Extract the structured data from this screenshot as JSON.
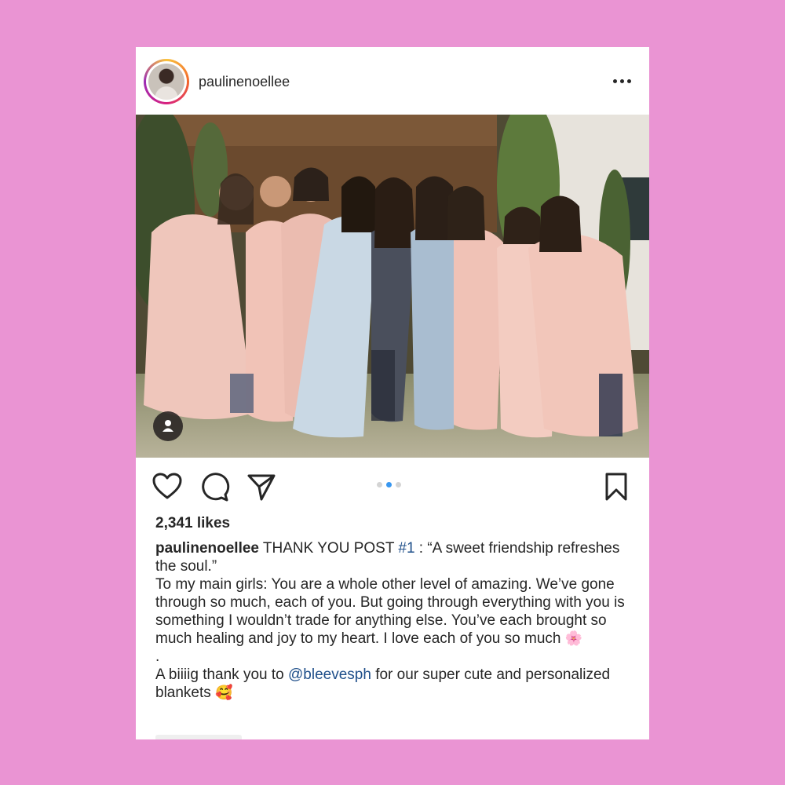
{
  "post": {
    "username": "paulinenoellee",
    "likes": "2,341 likes",
    "caption": {
      "username": "paulinenoellee",
      "line1_a": " THANK YOU POST ",
      "hashtag": "#1",
      "line1_b": " : “A sweet friendship refreshes the soul.”",
      "para2": "To my main girls: You are a whole other level of amazing. We’ve gone through so much, each of you. But going through everything with you is something I wouldn’t trade for anything else. You’ve each brought so much healing and joy to my heart. I love each of you so much",
      "para2_emoji": "🌸",
      "dot": ".",
      "para3_a": "A biiiig thank you to ",
      "mention": "@bleevesph",
      "para3_b": " for our super cute and personalized blankets",
      "para3_emoji": "🥰"
    },
    "carousel": {
      "count": 3,
      "active": 1
    }
  },
  "icons": {
    "header": "more-options-icon",
    "actions": [
      "heart-icon",
      "comment-icon",
      "share-icon",
      "bookmark-icon"
    ],
    "photo": "tagged-user-icon"
  },
  "colors": {
    "background": "#ea94d3",
    "link": "#1f4f8a",
    "carousel_active": "#3897f0"
  }
}
